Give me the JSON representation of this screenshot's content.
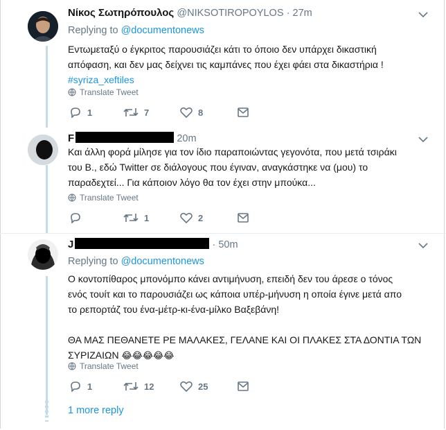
{
  "tweets": [
    {
      "name": "Νίκος Σωτηρόπουλος",
      "handle": "@NIKSOTIROPOYLOS",
      "time": "· 27m",
      "reply_prefix": "Replying to",
      "reply_handle": "@documentonews",
      "lines": [
        "Εντωμεταξύ ο έγκριτος παρουσιάζει κάτι το όποιο δεν υπάρχει δικαστική",
        "απόφαση,  και δεν μας δείχνει τις καμπάνες που έχει φάει  στα δικαστήρια !"
      ],
      "hashtag": "#syriza_xeftiles",
      "translate": "Translate Tweet",
      "replies": "1",
      "retweets": "7",
      "likes": "8"
    },
    {
      "name_initial": "F",
      "time": "20m",
      "lines": [
        "Και άλλη φορά μίλησε για τον ίδιο παραποιώντας γεγονότα, που μετά τσιράκι",
        "του Β., εδώ Twitter σε διάλογους που έγιναν, αναγκάστηκε να (μου) το",
        "παραδεχτεί... Για κάποιον λόγο θα τον έχει στην μπούκα..."
      ],
      "translate": "Translate Tweet",
      "replies": "",
      "retweets": "1",
      "likes": "2"
    },
    {
      "name_initial": "J",
      "time": "· 50m",
      "reply_prefix": "Replying to",
      "reply_handle": "@documentonews",
      "lines": [
        "Ο κοντοπίθαρος μπονόμπο κάνει αντιμήνυση, επειδή δεν του άρεσε ο τόνος",
        "ενός τουίτ και το παρουσιάζει ως κάποια υπέρ-μήνυση η οποία έγινε μετά απο",
        "το ρεπορτάζ του ένα-μέτρ-κι-ένα-μίλκο Βαξεβάνη!",
        "",
        "ΘΑ ΜΑΣ ΠΕΘΑΝΕΤΕ ΡΕ ΜΑΛΑΚΕΣ, ΓΕΛΑΝΕ ΚΑΙ ΟΙ ΠΛΑΚΕΣ ΣΤΑ ΔΟΝΤΙΑ ΤΩΝ",
        "ΣΥΡΙΖΑΙΩΝ"
      ],
      "emoji": "😂😂😂😂😂",
      "translate": "Translate Tweet",
      "replies": "1",
      "retweets": "12",
      "likes": "25"
    }
  ],
  "more_replies": "1 more reply",
  "icons": [
    "reply-icon",
    "retweet-icon",
    "like-icon",
    "message-icon",
    "globe-icon",
    "chevron-down-icon"
  ],
  "colors": {
    "link": "#1b95e0",
    "muted": "#657786",
    "thread_line": "#c4dbed"
  }
}
